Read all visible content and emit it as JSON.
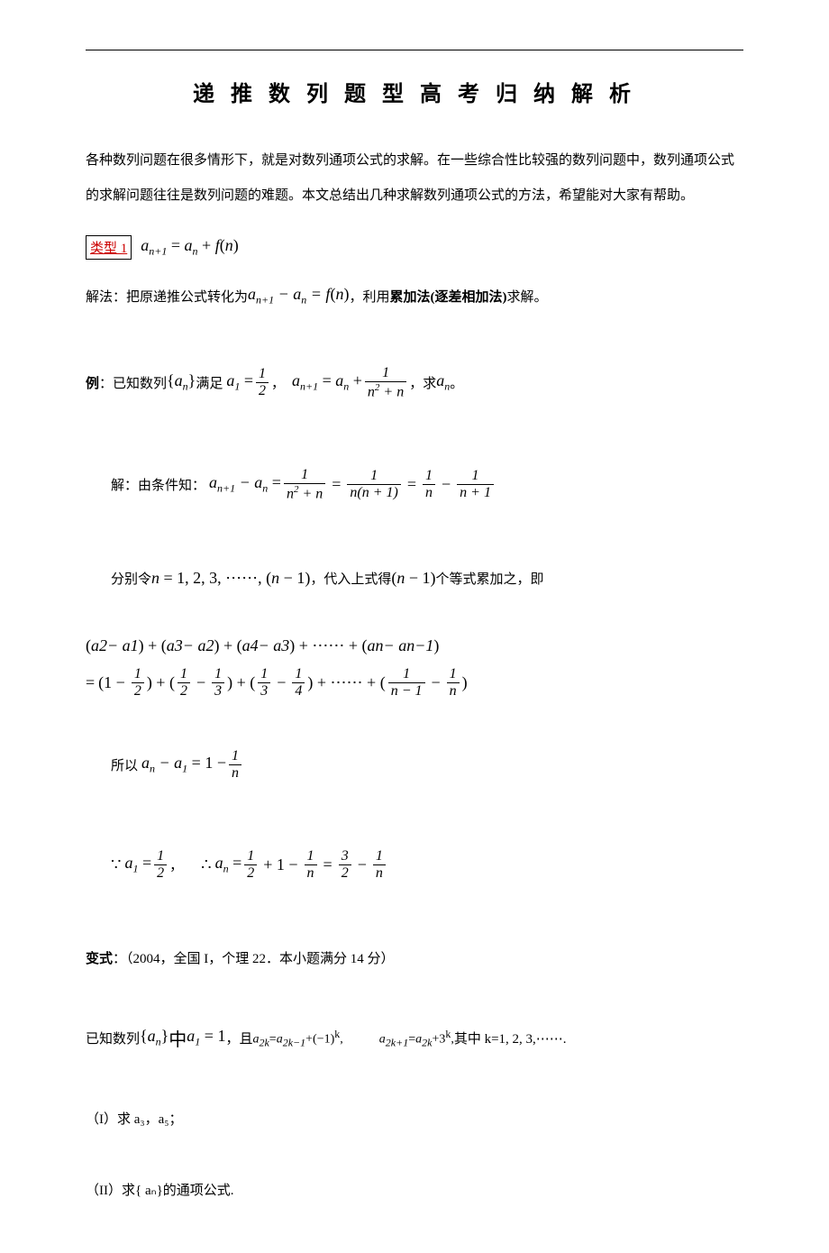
{
  "title": "递 推 数 列 题 型 高 考 归 纳 解 析",
  "intro": "各种数列问题在很多情形下，就是对数列通项公式的求解。在一些综合性比较强的数列问题中，数列通项公式的求解问题往往是数列问题的难题。本文总结出几种求解数列通项公式的方法，希望能对大家有帮助。",
  "type1": {
    "label": "类型 1",
    "formula": "aₙ₊₁ = aₙ + f(n)"
  },
  "method": {
    "prefix": "解法：把原递推公式转化为",
    "formula": "aₙ₊₁ − aₙ = f(n)",
    "suffix": "，利用",
    "bold": "累加法(逐差相加法)",
    "tail": "求解。"
  },
  "example": {
    "label": "例",
    "prefix": "：已知数列",
    "seq": "{aₙ}",
    "mid": "满足",
    "a1_lhs": "a₁ =",
    "a1_num": "1",
    "a1_den": "2",
    "comma": "，",
    "rec_lhs": "aₙ₊₁ = aₙ +",
    "rec_num": "1",
    "rec_den": "n² + n",
    "tail": "，求",
    "an": "aₙ",
    "dot": "。"
  },
  "solution_head": {
    "prefix": "解：由条件知：",
    "lhs": "aₙ₊₁ − aₙ =",
    "f1_num": "1",
    "f1_den": "n² + n",
    "eq": "=",
    "f2_num": "1",
    "f2_den": "n(n + 1)",
    "f3a_num": "1",
    "f3a_den": "n",
    "minus": "−",
    "f3b_num": "1",
    "f3b_den": "n + 1"
  },
  "substitute": {
    "prefix": "分别令",
    "range": "n = 1, 2, 3, ⋯⋯, (n − 1)",
    "mid": "，代入上式得",
    "count": "(n − 1)",
    "tail": "个等式累加之，即"
  },
  "expansion": {
    "line1": "(a₂ − a₁) + (a₃ − a₂) + (a₄ − a₃) + ⋯⋯ + (aₙ − aₙ₋₁)",
    "eq": "=",
    "t1a": "(1 −",
    "t1b_num": "1",
    "t1b_den": "2",
    "plus": ") + (",
    "t2a_num": "1",
    "t2a_den": "2",
    "minus": "−",
    "t2b_num": "1",
    "t2b_den": "3",
    "t3a_num": "1",
    "t3a_den": "3",
    "t3b_num": "1",
    "t3b_den": "4",
    "dots": ") + ⋯⋯ + (",
    "tna_num": "1",
    "tna_den": "n − 1",
    "tnb_num": "1",
    "tnb_den": "n",
    "close": ")"
  },
  "sum_result": {
    "prefix": "所以",
    "lhs": "aₙ − a₁ = 1 −",
    "f_num": "1",
    "f_den": "n"
  },
  "final": {
    "because": "∵",
    "a1": "a₁ =",
    "a1_num": "1",
    "a1_den": "2",
    "comma": "，",
    "therefore": "∴",
    "an": "aₙ =",
    "p1_num": "1",
    "p1_den": "2",
    "plus": "+ 1 −",
    "p2_num": "1",
    "p2_den": "n",
    "eq": "=",
    "p3_num": "3",
    "p3_den": "2",
    "minus": "−",
    "p4_num": "1",
    "p4_den": "n"
  },
  "variant": {
    "label": "变式",
    "citation": "：（2004，全国 I，个理 22．本小题满分 14 分）"
  },
  "variant_problem": {
    "prefix": "已知数列",
    "seq": "{aₙ}",
    "mid": "中",
    "a1": "a₁ = 1",
    "cond1_pre": "，且 ",
    "cond1": "a₂ₖ=a₂ₖ₋₁+(−1)ᵏ,",
    "cond2": "a₂ₖ₊₁=a₂ₖ+3ᵏ,",
    "tail": " 其中 k=1, 2, 3,⋯⋯."
  },
  "q1": "（I）求 a₃，a₅；",
  "q2": "（II）求{ aₙ}的通项公式."
}
